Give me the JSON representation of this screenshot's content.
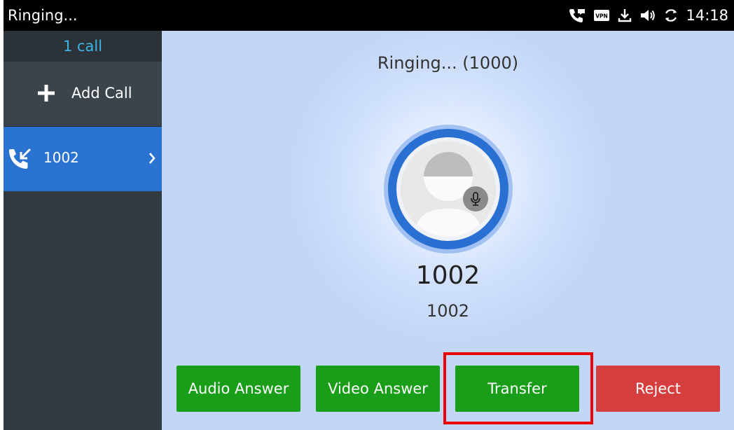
{
  "statusbar": {
    "title": "Ringing...",
    "time": "14:18",
    "icons": [
      "phone-call-icon",
      "vpn-icon",
      "download-icon",
      "volume-icon",
      "sync-icon"
    ],
    "vpn_label": "VPN"
  },
  "sidebar": {
    "call_count": "1 call",
    "add_call_label": "Add Call",
    "calls": [
      {
        "number": "1002",
        "icon": "incoming-call-icon"
      }
    ]
  },
  "main": {
    "status": "Ringing... (1000)",
    "caller_name": "1002",
    "caller_number": "1002"
  },
  "actions": {
    "audio_answer": "Audio Answer",
    "video_answer": "Video Answer",
    "transfer": "Transfer",
    "reject": "Reject"
  },
  "colors": {
    "accent_blue": "#2a73d0",
    "answer_green": "#1a9e1a",
    "reject_red": "#d63d3f",
    "highlight_red": "#ee0000",
    "call_count_text": "#3db5e6"
  }
}
